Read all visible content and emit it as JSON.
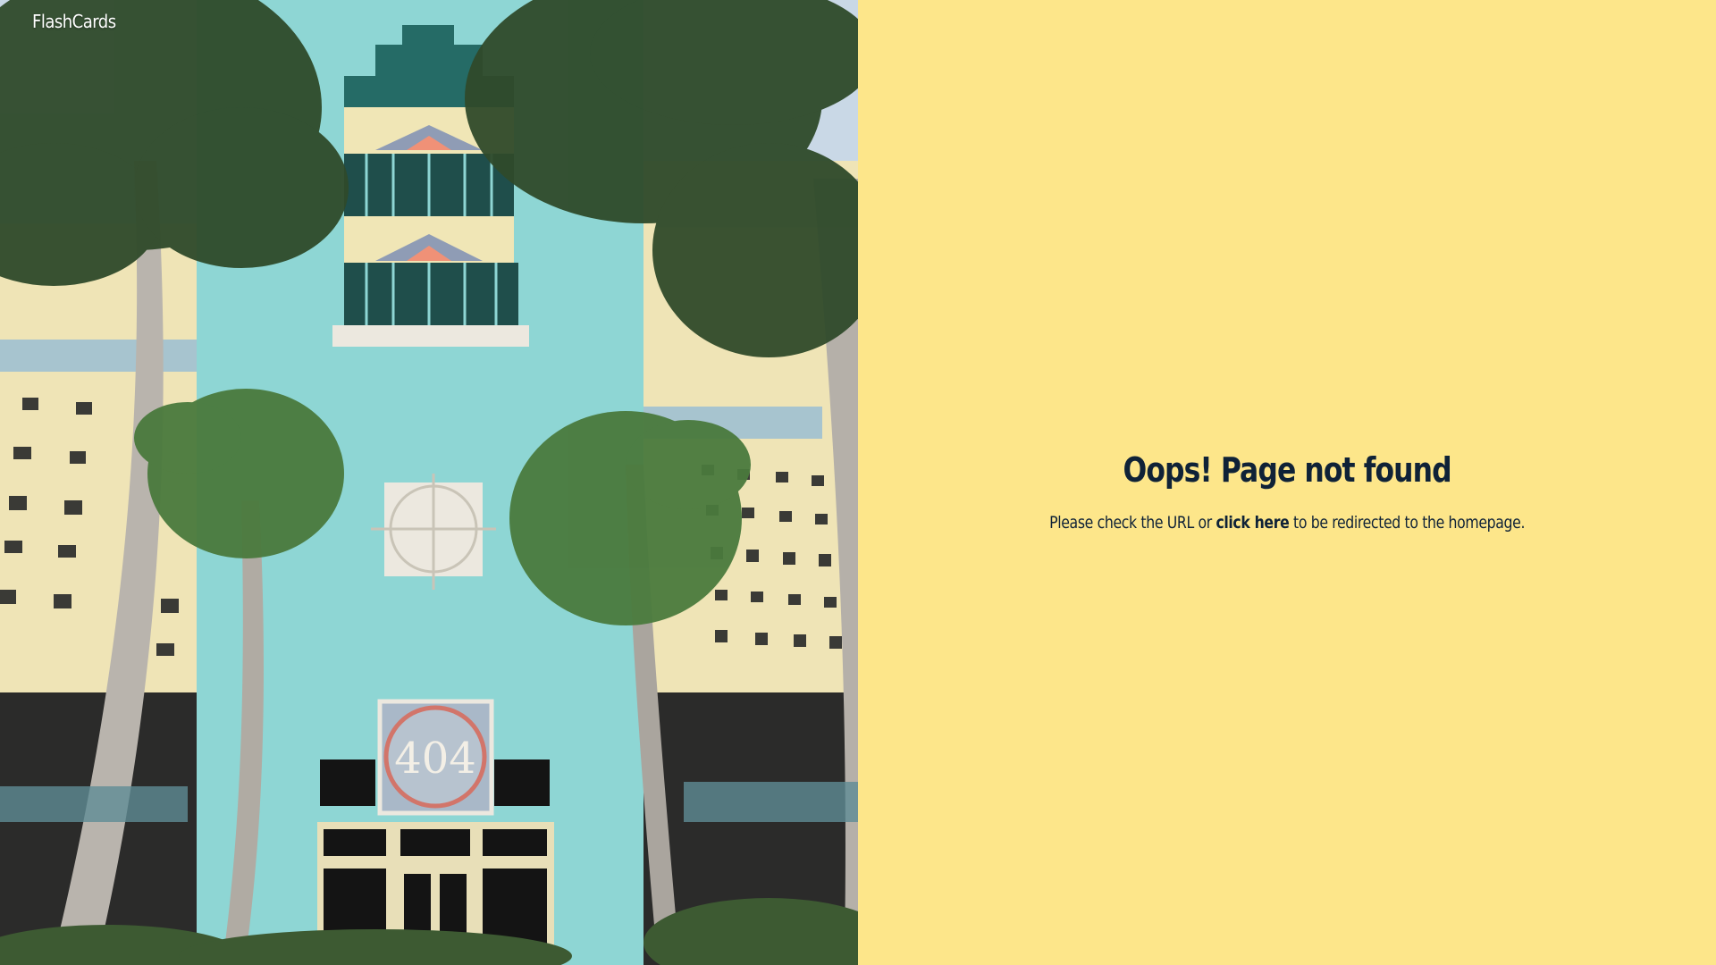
{
  "brand": {
    "name": "FlashCards"
  },
  "hero_image": {
    "sign_text": "404"
  },
  "error": {
    "title": "Oops! Page not found",
    "message_before": "Please check the URL or ",
    "link_text": "click here",
    "message_after": " to be redirected to the homepage."
  },
  "colors": {
    "panel_background": "#fde68a",
    "text": "#0f2237",
    "brand_text": "#ffffff"
  }
}
